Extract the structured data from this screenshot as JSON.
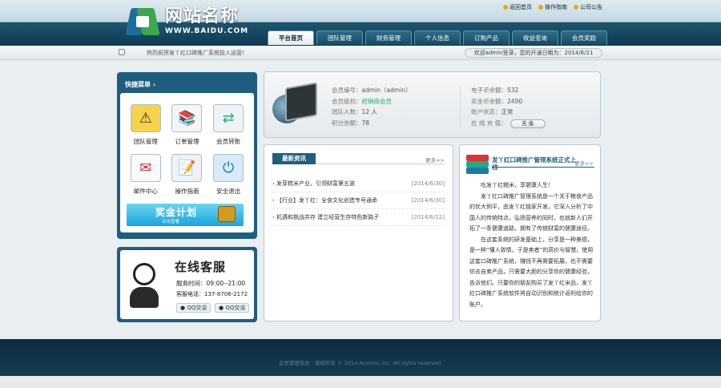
{
  "header": {
    "logo_name": "网站名称",
    "logo_url": "WWW.BAIDU.COM",
    "top_links": [
      "返回首页",
      "操作指南",
      "公司公告"
    ],
    "nav_tabs": [
      "平台首页",
      "团队管理",
      "财务管理",
      "个人信息",
      "订购产品",
      "收益查询",
      "会员奖励"
    ]
  },
  "ticker": {
    "message": "热烈祝贺发丫红口碑推广系统投入运营！",
    "welcome": "欢迎admin登录，您的开通日期为：2014/6/21"
  },
  "quick_menu": {
    "title": "快捷菜单",
    "items": [
      {
        "label": "团队管理",
        "icon": "traffic-sign-icon"
      },
      {
        "label": "订单管理",
        "icon": "books-icon"
      },
      {
        "label": "会员转账",
        "icon": "transfer-arrows-icon"
      },
      {
        "label": "邮件中心",
        "icon": "envelope-icon"
      },
      {
        "label": "操作指南",
        "icon": "notepad-icon"
      },
      {
        "label": "安全退出",
        "icon": "power-icon"
      }
    ],
    "bonus_title": "奖金计划",
    "bonus_sub": "点击查看"
  },
  "support": {
    "title": "在线客服",
    "hours": "服务时间：09:00--21:00",
    "phone": "客服电话：137-8706-2172",
    "qq1": "QQ交谈",
    "qq2": "QQ交谈"
  },
  "member_info": {
    "left": [
      {
        "label": "会员编号：",
        "value": "admin（admin）"
      },
      {
        "label": "会员级别：",
        "value": "经销商会员"
      },
      {
        "label": "团队人数：",
        "value": "12 人"
      },
      {
        "label": "积分余额：",
        "value": "78"
      }
    ],
    "right": [
      {
        "label": "电子币余额：",
        "value": "532"
      },
      {
        "label": "奖金币余额：",
        "value": "2490"
      },
      {
        "label": "账户状态：",
        "value": "正常"
      },
      {
        "label": "在 线 充 值：",
        "value": ""
      }
    ],
    "recharge_button": "充  值"
  },
  "news": {
    "title": "最新资讯",
    "more": "更多>>",
    "items": [
      {
        "title": "发芽糕米产业，引领财富第五波",
        "date": "[2014/6/30]"
      },
      {
        "title": "【行业】发丫红：全食文化创造专号通承",
        "date": "[2014/6/30]"
      },
      {
        "title": "机遇和挑战并存 建立经营生存特色新路子",
        "date": "[2014/6/12]"
      }
    ]
  },
  "intro": {
    "title": "发丫红口碑推广管理系统正式上线",
    "more": "更多>>",
    "paragraphs": [
      "吃发丫红糙米，享健康人生！",
      "发丫红口碑推广管理系统是一个关于粮食产品的优大例平，由发丫红独家开发，它深入分析了中国人的传统特点，弘扬营养的同时，也就新人们开拓了一条健康道路，拥有了传统财富的健康途径。",
      "在这套系统的研发基础上，分享是一种美德，是一种“懂人致情，于是卖者”的高价与智慧。使用这套口碑推广系统，赚钱不再需要拓展，也不需要你去自卖产品，只需要大胆的分享你的健康经验，告诉他们。只要你的朋友购买了发丫红米品，发丫红口碑推广系统软件将自动识别和统计返利给你的账户。"
    ]
  },
  "footer": {
    "copyright": "会员管理系统 · 版权所有 © 2014 Acomm, Inc. All rights reserved."
  }
}
